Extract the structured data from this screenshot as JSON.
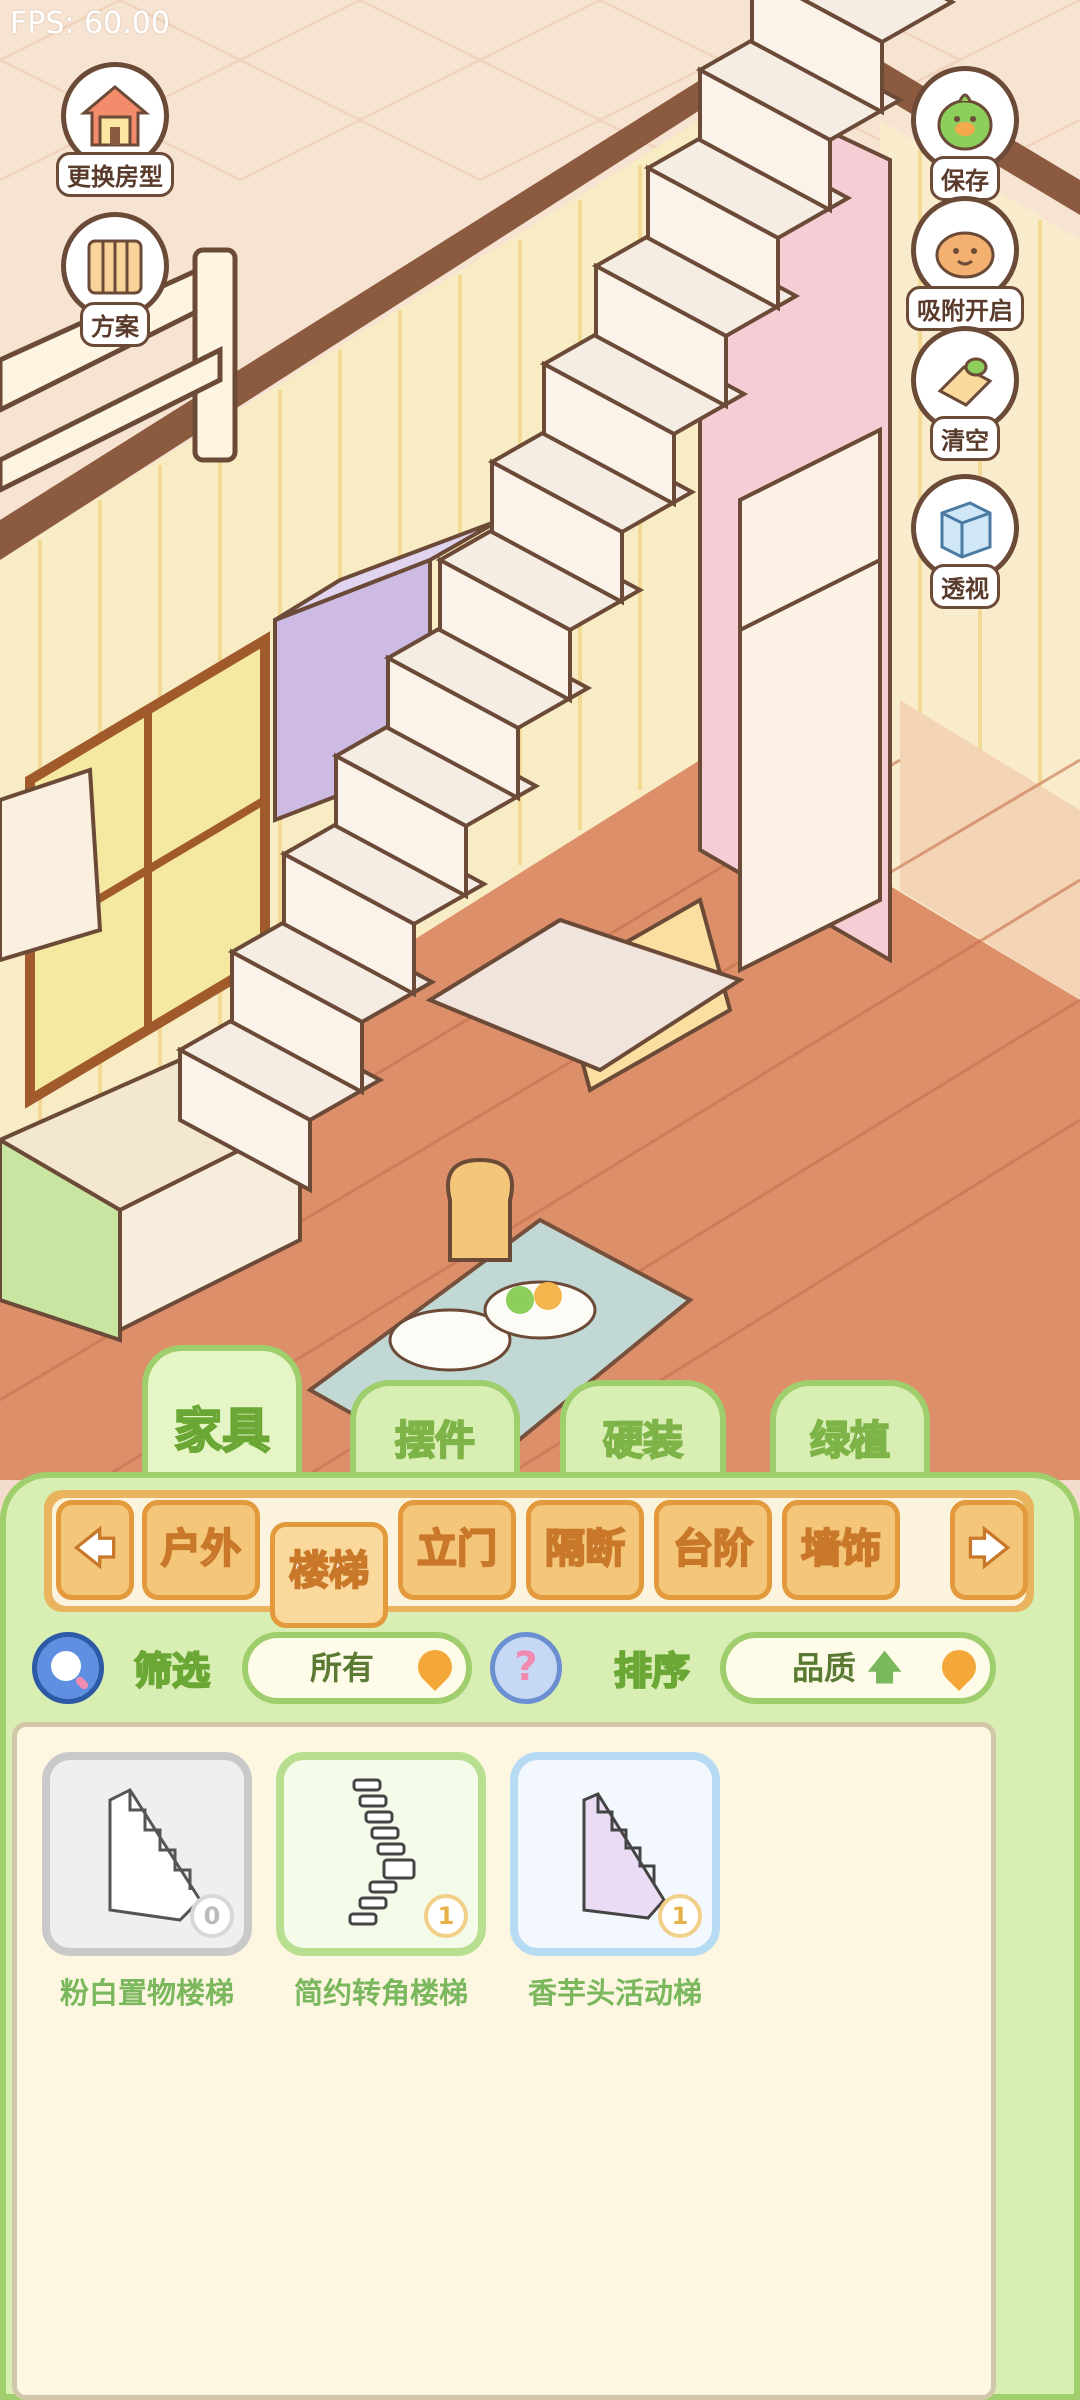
{
  "fps": "FPS: 60.00",
  "side_left": [
    {
      "label": "更换房型",
      "icon": "house-icon"
    },
    {
      "label": "方案",
      "icon": "plan-icon"
    }
  ],
  "side_right": [
    {
      "label": "保存",
      "icon": "save-bird-icon"
    },
    {
      "label": "吸附开启",
      "icon": "magnet-icon"
    },
    {
      "label": "清空",
      "icon": "clear-icon"
    },
    {
      "label": "透视",
      "icon": "perspective-cube-icon"
    }
  ],
  "tabs": [
    {
      "label": "家具",
      "active": true
    },
    {
      "label": "摆件",
      "active": false
    },
    {
      "label": "硬装",
      "active": false
    },
    {
      "label": "绿植",
      "active": false
    }
  ],
  "categories": [
    {
      "label": "户外"
    },
    {
      "label": "楼梯",
      "active": true
    },
    {
      "label": "立门"
    },
    {
      "label": "隔断"
    },
    {
      "label": "台阶"
    },
    {
      "label": "墙饰"
    }
  ],
  "filter": {
    "label": "筛选",
    "value": "所有"
  },
  "sort": {
    "label": "排序",
    "value": "品质"
  },
  "items": [
    {
      "name": "粉白置物楼梯",
      "count": "0",
      "rarity": "gray"
    },
    {
      "name": "简约转角楼梯",
      "count": "1",
      "rarity": "green"
    },
    {
      "name": "香芋头活动梯",
      "count": "1",
      "rarity": "blue"
    }
  ],
  "colors": {
    "panel_green": "#d9eeb3",
    "panel_border": "#9fce6c",
    "category_orange": "#f4c67a",
    "stair_pink": "#ec9fb1",
    "floor_wood": "#dd8f6a"
  }
}
